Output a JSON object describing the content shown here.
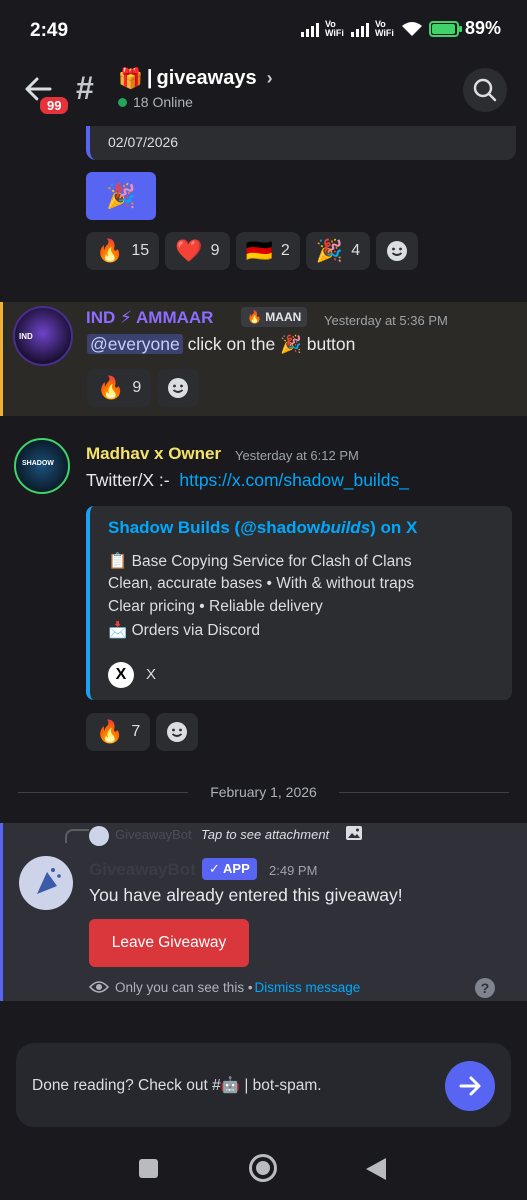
{
  "status_bar": {
    "time": "2:49",
    "network_1": "Vo WiFi",
    "network_2": "Vo WiFi",
    "battery_percent": "89%",
    "battery_level": 0.89
  },
  "header": {
    "unread_badge": "99",
    "channel_emoji": "🎁",
    "channel_name": "giveaways",
    "online": "18 Online"
  },
  "prev_message": {
    "embed_date": "02/07/2026",
    "button_emoji": "🎉",
    "reactions": [
      {
        "emoji": "🔥",
        "count": "15"
      },
      {
        "emoji": "❤️",
        "count": "9"
      },
      {
        "emoji": "🇩🇪",
        "count": "2"
      },
      {
        "emoji": "🎉",
        "count": "4"
      }
    ]
  },
  "message_ammaar": {
    "username": "IND ⚡ AMMAAR",
    "role_tag": "MAAN",
    "role_emoji": "🔥",
    "timestamp": "Yesterday at 5:36 PM",
    "mention": "@everyone",
    "text_1": "click on the",
    "text_emoji": "🎉",
    "text_2": "button",
    "reaction": {
      "emoji": "🔥",
      "count": "9"
    }
  },
  "message_madhav": {
    "username": "Madhav x Owner",
    "timestamp": "Yesterday at 6:12 PM",
    "text_prefix": "Twitter/X :-",
    "link": "https://x.com/shadow_builds_",
    "embed": {
      "title_1": "Shadow Builds (@shadow",
      "title_italic": "builds",
      "title_2": ") on X",
      "line_1": "📋 Base Copying Service for Clash of Clans",
      "line_2": "Clean, accurate bases • With & without traps",
      "line_3": "Clear pricing • Reliable delivery",
      "line_4": "📩 Orders via Discord",
      "footer_logo": "X",
      "footer": "X"
    },
    "reaction": {
      "emoji": "🔥",
      "count": "7"
    }
  },
  "date_divider": "February 1, 2026",
  "bot_message": {
    "reply_name": "GiveawayBot",
    "reply_hint": "Tap to see attachment",
    "username": "GiveawayBot",
    "app_tag": "✓ APP",
    "timestamp": "2:49 PM",
    "text": "You have already entered this giveaway!",
    "button": "Leave Giveaway",
    "only_you": "Only you can see this •",
    "dismiss": "Dismiss message",
    "help": "?"
  },
  "input_bar": {
    "text_1": "Done reading? Check out #",
    "emoji": "🤖",
    "text_2": "bot-spam."
  }
}
